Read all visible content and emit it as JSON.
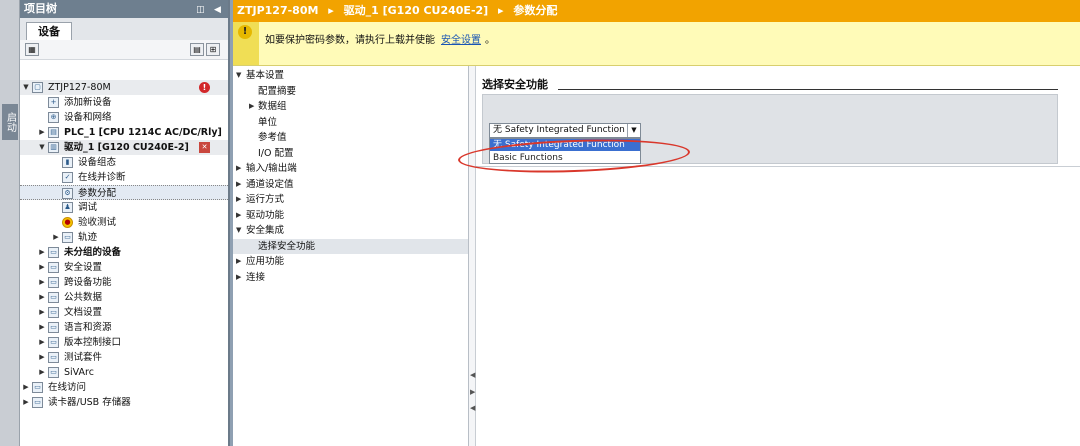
{
  "left_strip": {
    "label": "启动"
  },
  "project_tree": {
    "title": "项目树",
    "tab": "设备",
    "items": [
      {
        "label": "ZTJP127-80M"
      },
      {
        "label": "添加新设备"
      },
      {
        "label": "设备和网络"
      },
      {
        "label": "PLC_1 [CPU 1214C AC/DC/Rly]"
      },
      {
        "label": "驱动_1 [G120 CU240E-2]"
      },
      {
        "label": "设备组态"
      },
      {
        "label": "在线并诊断"
      },
      {
        "label": "参数分配"
      },
      {
        "label": "调试"
      },
      {
        "label": "验收测试"
      },
      {
        "label": "轨迹"
      },
      {
        "label": "未分组的设备"
      },
      {
        "label": "安全设置"
      },
      {
        "label": "跨设备功能"
      },
      {
        "label": "公共数据"
      },
      {
        "label": "文档设置"
      },
      {
        "label": "语言和资源"
      },
      {
        "label": "版本控制接口"
      },
      {
        "label": "测试套件"
      },
      {
        "label": "SiVArc"
      },
      {
        "label": "在线访问"
      },
      {
        "label": "读卡器/USB 存储器"
      }
    ]
  },
  "breadcrumb": {
    "parts": [
      "ZTJP127-80M",
      "▸",
      "驱动_1 [G120 CU240E-2]",
      "▸",
      "参数分配"
    ]
  },
  "warning": {
    "text": "如要保护密码参数，请执行上载并使能",
    "link": "安全设置",
    "suffix": "。"
  },
  "param_nav": {
    "items": [
      {
        "label": "基本设置"
      },
      {
        "label": "配置摘要"
      },
      {
        "label": "数据组"
      },
      {
        "label": "单位"
      },
      {
        "label": "参考值"
      },
      {
        "label": "I/O 配置"
      },
      {
        "label": "输入/输出端"
      },
      {
        "label": "通道设定值"
      },
      {
        "label": "运行方式"
      },
      {
        "label": "驱动功能"
      },
      {
        "label": "安全集成"
      },
      {
        "label": "选择安全功能"
      },
      {
        "label": "应用功能"
      },
      {
        "label": "连接"
      }
    ]
  },
  "content": {
    "section_title": "选择安全功能",
    "dropdown_value": "无 Safety Integrated Function",
    "options": [
      "无 Safety Integrated Function",
      "Basic Functions"
    ]
  },
  "colors": {
    "breadcrumb_bg": "#f2a300",
    "warning_bg": "#fffbb8",
    "highlight": "#d9372b",
    "selected_option": "#3a6fd0"
  }
}
